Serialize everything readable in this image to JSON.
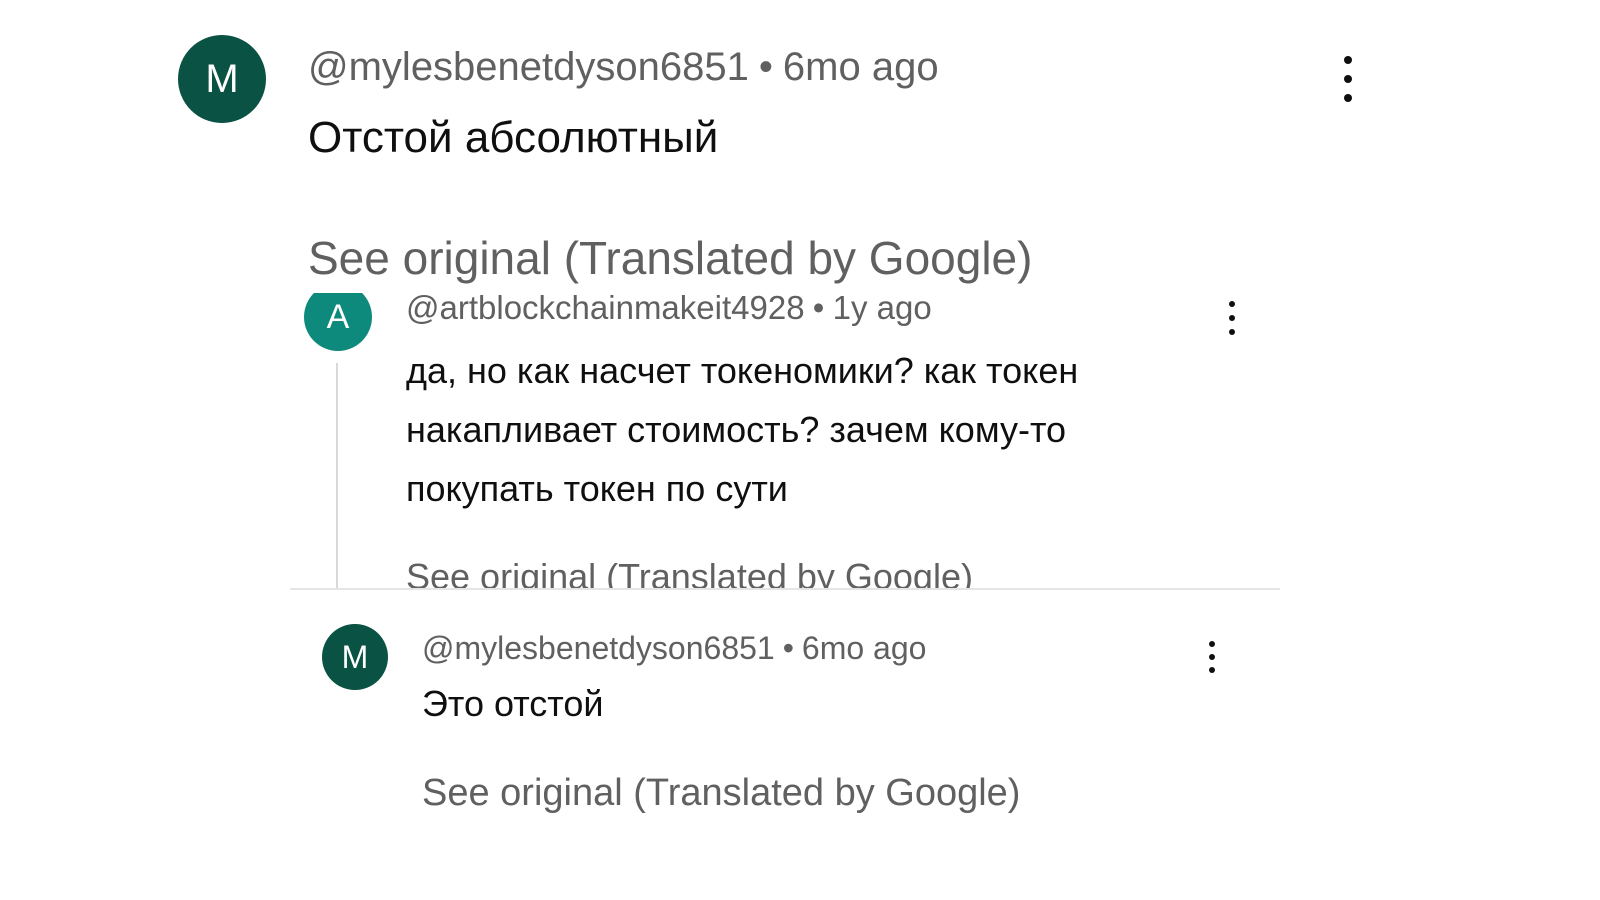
{
  "comments": [
    {
      "avatar_letter": "M",
      "avatar_color": "#0a5243",
      "author": "@mylesbenetdyson6851",
      "separator": "•",
      "time": "6mo ago",
      "text": "Отстой абсолютный",
      "see_original": "See original (Translated by Google)",
      "menu_icon": "more-vertical-icon"
    },
    {
      "avatar_letter": "A",
      "avatar_color": "#0e8a7d",
      "author": "@artblockchainmakeit4928",
      "separator": "•",
      "time": "1y ago",
      "text": "да, но как насчет токеномики? как токен накапливает стоимость? зачем кому-то покупать токен по сути",
      "see_original": "See original (Translated by Google)",
      "menu_icon": "more-vertical-icon"
    },
    {
      "avatar_letter": "M",
      "avatar_color": "#0a5243",
      "author": "@mylesbenetdyson6851",
      "separator": "•",
      "time": "6mo ago",
      "text": "Это отстой",
      "see_original": "See original (Translated by Google)",
      "menu_icon": "more-vertical-icon"
    }
  ],
  "colors": {
    "meta_text": "#606060",
    "body_text": "#0f0f0f",
    "thread_line": "#d9d9d9",
    "divider": "#e5e5e5",
    "background": "#ffffff"
  }
}
